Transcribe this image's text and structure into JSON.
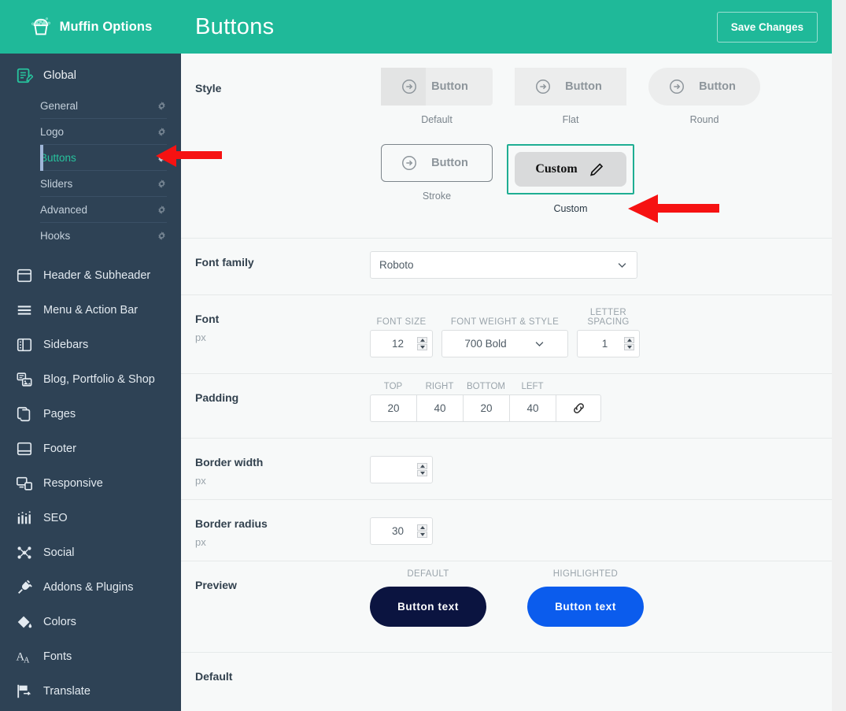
{
  "brand": {
    "title": "Muffin Options",
    "logo_icon": "muffin-icon",
    "bg": "#1fb999"
  },
  "sidebar": {
    "group": {
      "label": "Global",
      "icon": "edit-document-icon",
      "items": [
        {
          "label": "General",
          "icon": "gear-icon",
          "active": false
        },
        {
          "label": "Logo",
          "icon": "gear-icon",
          "active": false
        },
        {
          "label": "Buttons",
          "icon": "gear-icon",
          "active": true
        },
        {
          "label": "Sliders",
          "icon": "gear-icon",
          "active": false
        },
        {
          "label": "Advanced",
          "icon": "gear-icon",
          "active": false
        },
        {
          "label": "Hooks",
          "icon": "gear-icon",
          "active": false
        }
      ]
    },
    "items": [
      {
        "label": "Header & Subheader",
        "icon": "layout-header-icon"
      },
      {
        "label": "Menu & Action Bar",
        "icon": "hamburger-menu-icon"
      },
      {
        "label": "Sidebars",
        "icon": "layout-sidebar-icon"
      },
      {
        "label": "Blog, Portfolio & Shop",
        "icon": "blog-posts-icon"
      },
      {
        "label": "Pages",
        "icon": "copy-pages-icon"
      },
      {
        "label": "Footer",
        "icon": "layout-footer-icon"
      },
      {
        "label": "Responsive",
        "icon": "devices-responsive-icon"
      },
      {
        "label": "SEO",
        "icon": "seo-bars-icon"
      },
      {
        "label": "Social",
        "icon": "social-share-icon"
      },
      {
        "label": "Addons & Plugins",
        "icon": "plug-icon"
      },
      {
        "label": "Colors",
        "icon": "paint-bucket-icon"
      },
      {
        "label": "Fonts",
        "icon": "font-letters-icon"
      },
      {
        "label": "Translate",
        "icon": "flag-translate-icon"
      }
    ],
    "active_indicator_color": "#9fb6d8",
    "bg": "#2e4255"
  },
  "header": {
    "title": "Buttons",
    "save_label": "Save Changes"
  },
  "style_section": {
    "label": "Style",
    "options": [
      {
        "caption": "Default",
        "button_text": "Button",
        "icon": "arrow-circle-right-icon",
        "variant": "default",
        "selected": false
      },
      {
        "caption": "Flat",
        "button_text": "Button",
        "icon": "arrow-circle-right-icon",
        "variant": "flat",
        "selected": false
      },
      {
        "caption": "Round",
        "button_text": "Button",
        "icon": "arrow-circle-right-icon",
        "variant": "round",
        "selected": false
      },
      {
        "caption": "Stroke",
        "button_text": "Button",
        "icon": "arrow-circle-right-icon",
        "variant": "stroke",
        "selected": false
      },
      {
        "caption": "Custom",
        "button_text": "Custom",
        "icon": "pencil-edit-icon",
        "variant": "custom",
        "selected": true
      }
    ],
    "selected_outline_color": "#1fae93"
  },
  "font_family_section": {
    "label": "Font family",
    "value": "Roboto"
  },
  "font_section": {
    "label": "Font",
    "unit": "px",
    "fields": [
      {
        "head": "FONT SIZE",
        "value": "12",
        "type": "number"
      },
      {
        "head": "FONT WEIGHT & STYLE",
        "value": "700 Bold",
        "type": "select"
      },
      {
        "head": "LETTER SPACING",
        "value": "1",
        "type": "number"
      }
    ]
  },
  "padding_section": {
    "label": "Padding",
    "heads": [
      "TOP",
      "RIGHT",
      "BOTTOM",
      "LEFT"
    ],
    "values": [
      "20",
      "40",
      "20",
      "40"
    ],
    "link_icon": "chain-link-icon"
  },
  "border_width_section": {
    "label": "Border width",
    "unit": "px",
    "value": ""
  },
  "border_radius_section": {
    "label": "Border radius",
    "unit": "px",
    "value": "30"
  },
  "preview_section": {
    "label": "Preview",
    "items": [
      {
        "head": "DEFAULT",
        "text": "Button text",
        "bg": "#0b1440"
      },
      {
        "head": "HIGHLIGHTED",
        "text": "Button text",
        "bg": "#0b5ced"
      }
    ]
  },
  "default_section": {
    "label": "Default"
  },
  "annotations": {
    "color": "#f61212",
    "arrows": [
      {
        "name": "arrow-pointing-to-buttons-menu-item"
      },
      {
        "name": "arrow-pointing-to-custom-style-option"
      }
    ]
  }
}
